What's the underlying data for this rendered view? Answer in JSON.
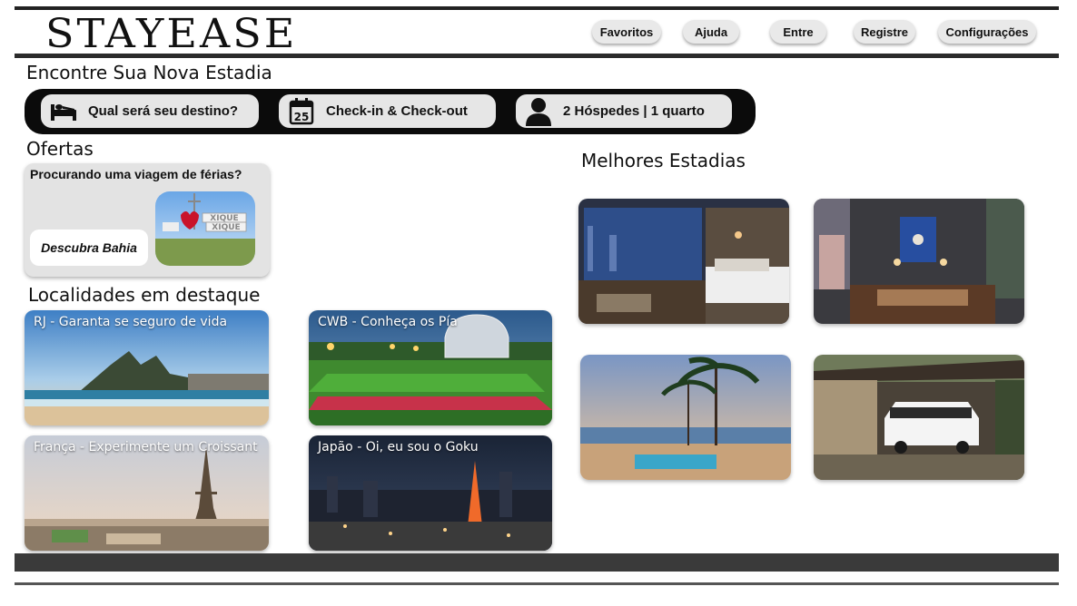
{
  "header": {
    "logo": "STAYEASE",
    "nav": [
      "Favoritos",
      "Ajuda",
      "Entre",
      "Registre",
      "Configurações"
    ]
  },
  "search": {
    "title": "Encontre Sua Nova Estadia",
    "destination": "Qual será seu destino?",
    "dates": "Check-in  & Check-out",
    "calendar_day": "25",
    "guests": "2 Hóspedes | 1 quarto"
  },
  "offers": {
    "title": "Ofertas",
    "question": "Procurando uma viagem de férias?",
    "cta": "Descubra Bahia",
    "sign_text": "XIQUE XIQUE"
  },
  "featured": {
    "title": "Localidades em destaque",
    "items": [
      {
        "caption": "RJ - Garanta se seguro de vida"
      },
      {
        "caption": "CWB - Conheça os Pía"
      },
      {
        "caption": "França - Experimente um Croissant"
      },
      {
        "caption": "Japão - Oi, eu sou o Goku"
      }
    ]
  },
  "best": {
    "title": "Melhores Estadias"
  },
  "icons": {
    "destination": "bed-icon",
    "dates": "calendar-icon",
    "guests": "person-icon"
  },
  "colors": {
    "bar": "#0b0b0b",
    "pill": "#e6e6e6",
    "footer": "#3a3a3a"
  }
}
